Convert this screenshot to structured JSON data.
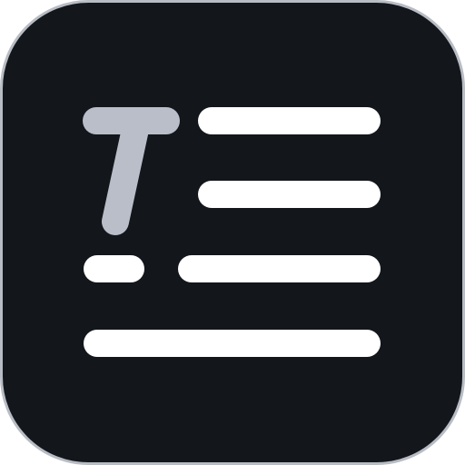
{
  "icon": {
    "name": "text-editor-app-icon",
    "colors": {
      "tile_background": "#13161b",
      "tile_border": "#b8bcc4",
      "letter_t": "#b9bec9",
      "text_lines": "#ffffff"
    }
  }
}
